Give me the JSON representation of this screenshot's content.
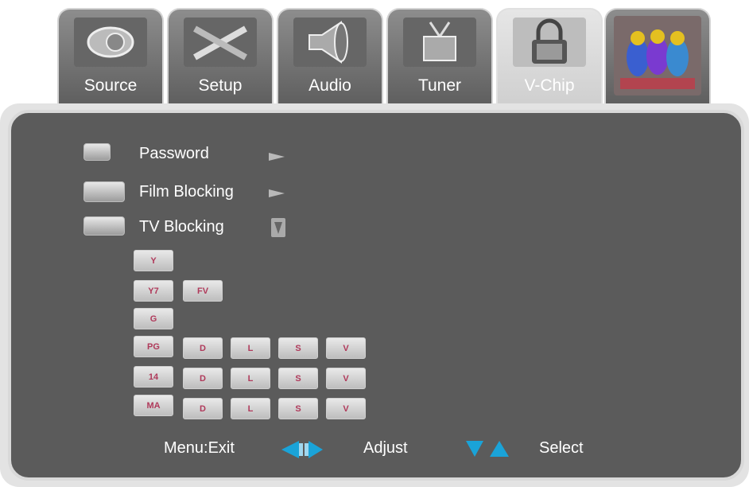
{
  "tabs": [
    {
      "label": "Source",
      "icon": "source-icon"
    },
    {
      "label": "Setup",
      "icon": "setup-icon"
    },
    {
      "label": "Audio",
      "icon": "audio-icon"
    },
    {
      "label": "Tuner",
      "icon": "tuner-icon"
    },
    {
      "label": "V-Chip",
      "icon": "lock-icon",
      "active": true
    },
    {
      "label": "",
      "icon": "brand-logo"
    }
  ],
  "menu": {
    "items": [
      {
        "label": "Password",
        "icon": "password-icon",
        "arrow": "right"
      },
      {
        "label": "Film Blocking",
        "icon": "film-icon",
        "arrow": "right"
      },
      {
        "label": "TV Blocking",
        "icon": "tv-icon",
        "arrow": "down"
      }
    ]
  },
  "ratings": {
    "rows": [
      {
        "rating": "Y",
        "options": []
      },
      {
        "rating": "Y7",
        "options": [
          "FV"
        ]
      },
      {
        "rating": "G",
        "options": []
      },
      {
        "rating": "PG",
        "options": [
          "D",
          "L",
          "S",
          "V"
        ]
      },
      {
        "rating": "14",
        "options": [
          "D",
          "L",
          "S",
          "V"
        ]
      },
      {
        "rating": "MA",
        "options": [
          "D",
          "L",
          "S",
          "V"
        ]
      }
    ]
  },
  "footer": {
    "exit": "Menu:Exit",
    "adjust": "Adjust",
    "select": "Select"
  },
  "colors": {
    "panel": "#5b5b5b",
    "accent_arrow": "#1aa3d8",
    "rating_text": "#b03a5b"
  }
}
